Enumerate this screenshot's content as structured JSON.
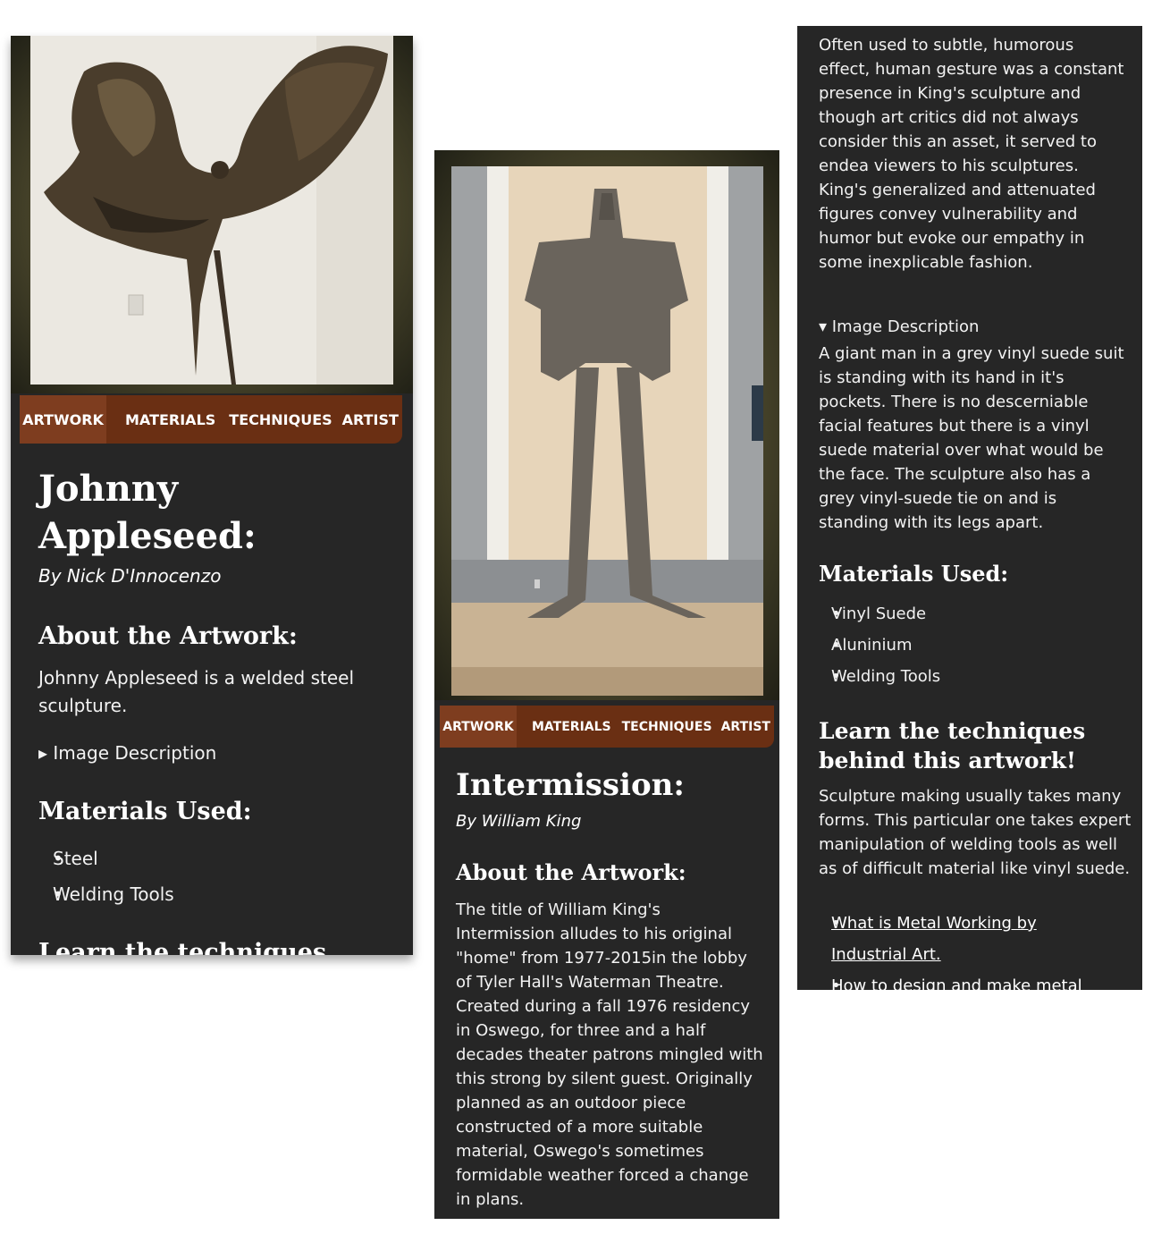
{
  "tabs": [
    "ARTWORK",
    "MATERIALS",
    "TECHNIQUES",
    "ARTIST"
  ],
  "artwork1": {
    "title": "Johnny Appleseed:",
    "artist": "By Nick D'Innocenzo",
    "about_heading": "About the Artwork:",
    "about_text": "Johnny Appleseed is a welded steel sculpture.",
    "image_description_toggle": "▸ Image Description",
    "materials_heading": "Materials Used:",
    "materials": [
      "Steel",
      "Welding Tools"
    ],
    "techniques_heading_partial": "Learn the techniques"
  },
  "artwork2": {
    "title": "Intermission:",
    "artist": "By William King",
    "about_heading": "About the Artwork:",
    "about_text": "The title of William King's Intermission alludes to his original \"home\" from 1977-2015in the lobby of Tyler Hall's Waterman Theatre. Created during a fall 1976 residency in Oswego, for three and a half decades theater patrons mingled with this strong by silent guest. Originally planned as an outdoor piece constructed of a more suitable material, Oswego's sometimes formidable weather forced a change in plans."
  },
  "artwork2_continued": {
    "about_text_cont": "Often used to subtle, humorous effect, human gesture was a constant presence in King's sculpture and though art critics did not always consider this an asset, it served to endea viewers to his sculptures. King's generalized and attenuated figures convey vulnerability and humor but evoke our empathy in some inexplicable fashion.",
    "image_description_toggle": "▾ Image Description",
    "image_description_text": "A giant man in a grey vinyl suede suit is standing with its hand in it's pockets. There is no descerniable facial features but there is a vinyl suede material over what would be the face. The sculpture also has a grey vinyl-suede tie on and is standing with its legs apart.",
    "materials_heading": "Materials Used:",
    "materials": [
      "Vinyl Suede",
      "Aluninium",
      "Welding Tools"
    ],
    "techniques_heading": "Learn the techniques behind this artwork!",
    "techniques_text": "Sculpture making usually takes many forms. This particular one takes expert manipulation of welding tools as well as of difficult material like vinyl suede.",
    "links": [
      "What is Metal Working by Industrial Art.",
      "How to design and make metal"
    ]
  },
  "colors": {
    "panel_bg": "#262626",
    "tab_bar": "#6a2f13",
    "tab_active": "#7e3d1f",
    "text": "#f4f4f4"
  }
}
